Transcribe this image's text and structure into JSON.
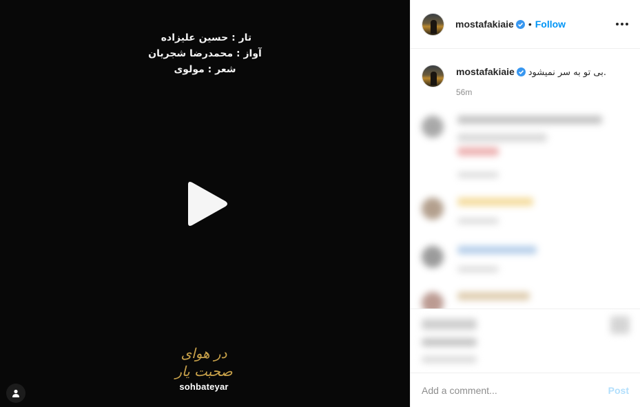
{
  "media": {
    "credits": [
      "تار : حسین علیزاده",
      "آواز : محمدرضا شجریان",
      "شعر :  مولوی"
    ],
    "logo_script": "در هوای صحبت یار",
    "logo_word": "sohbateyar",
    "play_icon": "play-icon",
    "user_tag_icon": "user-icon"
  },
  "header": {
    "username": "mostafakiaie",
    "separator": "•",
    "follow_label": "Follow",
    "more_icon": "more-horizontal-icon"
  },
  "caption": {
    "username": "mostafakiaie",
    "text": "بی تو به سر نمیشود.",
    "time": "56m"
  },
  "comment_box": {
    "placeholder": "Add a comment...",
    "post_label": "Post"
  },
  "colors": {
    "accent": "#0095f6",
    "post_disabled": "#b2dffc",
    "verified": "#3897f0"
  }
}
